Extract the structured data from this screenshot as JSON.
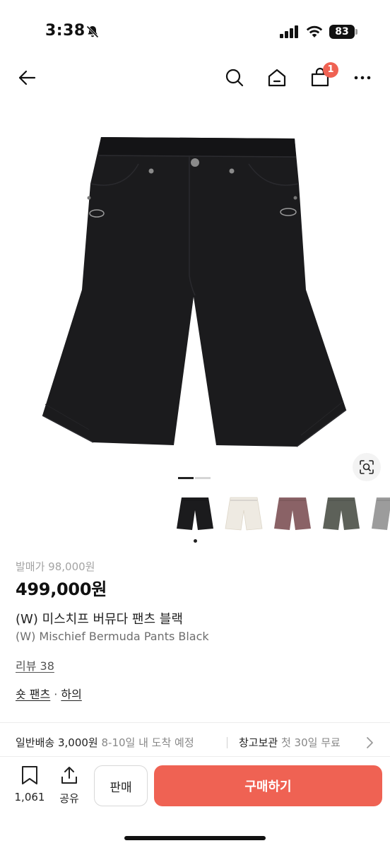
{
  "status_bar": {
    "time": "3:38",
    "battery": "83",
    "icons": [
      "bell-slash-icon",
      "signal-icon",
      "wifi-icon",
      "battery-icon"
    ]
  },
  "nav": {
    "icons": [
      "back-arrow-icon",
      "search-icon",
      "home-icon",
      "shopping-bag-icon",
      "more-icon"
    ],
    "cart_badge": "1"
  },
  "product": {
    "original_price": "발매가 98,000원",
    "price": "499,000원",
    "title_ko": "(W) 미스치프 버뮤다 팬츠 블랙",
    "title_en": "(W) Mischief Bermuda Pants Black",
    "reviews": "리뷰 38",
    "category_main": "숏 팬츠",
    "category_sep": "·",
    "category_sub": "하의",
    "image_pager": {
      "total": 2,
      "active": 1
    },
    "thumbnail_colors": [
      "#1b1b1d",
      "#eeeae2",
      "#8a6266",
      "#5d6159",
      "#9c9c9c"
    ],
    "selected_thumbnail": 1
  },
  "shipping": {
    "general_label": "일반배송 3,000원",
    "general_detail": "8-10일 내 도착 예정",
    "storage_label": "창고보관",
    "storage_detail": "첫 30일 무료"
  },
  "bottom_bar": {
    "wish_count": "1,061",
    "share_label": "공유",
    "sell_label": "판매",
    "buy_label": "구매하기"
  },
  "colors": {
    "accent": "#ef6253",
    "muted_text": "#a3a3a3"
  }
}
